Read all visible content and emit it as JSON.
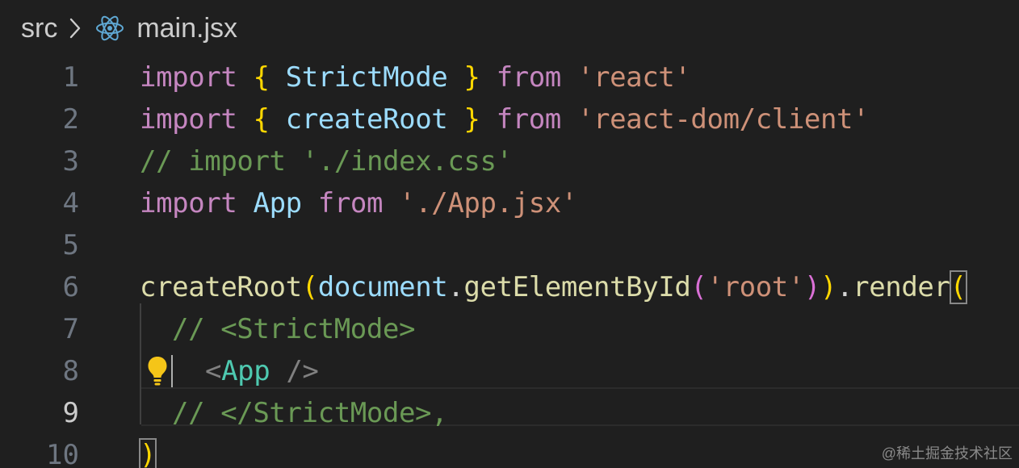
{
  "breadcrumb": {
    "folder": "src",
    "file": "main.jsx",
    "separator_icon": "chevron-right-icon",
    "file_icon": "react-icon"
  },
  "editor": {
    "active_line": "9",
    "lines": [
      {
        "num": "1",
        "tokens": [
          {
            "t": "import",
            "c": "kw"
          },
          {
            "t": " ",
            "c": "plain"
          },
          {
            "t": "{",
            "c": "br1"
          },
          {
            "t": " StrictMode ",
            "c": "ident"
          },
          {
            "t": "}",
            "c": "br1"
          },
          {
            "t": " ",
            "c": "plain"
          },
          {
            "t": "from",
            "c": "kw"
          },
          {
            "t": " ",
            "c": "plain"
          },
          {
            "t": "'react'",
            "c": "str"
          }
        ]
      },
      {
        "num": "2",
        "tokens": [
          {
            "t": "import",
            "c": "kw"
          },
          {
            "t": " ",
            "c": "plain"
          },
          {
            "t": "{",
            "c": "br1"
          },
          {
            "t": " createRoot ",
            "c": "ident"
          },
          {
            "t": "}",
            "c": "br1"
          },
          {
            "t": " ",
            "c": "plain"
          },
          {
            "t": "from",
            "c": "kw"
          },
          {
            "t": " ",
            "c": "plain"
          },
          {
            "t": "'react-dom/client'",
            "c": "str"
          }
        ]
      },
      {
        "num": "3",
        "tokens": [
          {
            "t": "// import './index.css'",
            "c": "cmt"
          }
        ]
      },
      {
        "num": "4",
        "tokens": [
          {
            "t": "import",
            "c": "kw"
          },
          {
            "t": " ",
            "c": "plain"
          },
          {
            "t": "App",
            "c": "ident"
          },
          {
            "t": " ",
            "c": "plain"
          },
          {
            "t": "from",
            "c": "kw"
          },
          {
            "t": " ",
            "c": "plain"
          },
          {
            "t": "'./App.jsx'",
            "c": "str"
          }
        ]
      },
      {
        "num": "5",
        "tokens": []
      },
      {
        "num": "6",
        "tokens": [
          {
            "t": "createRoot",
            "c": "fn"
          },
          {
            "t": "(",
            "c": "br1"
          },
          {
            "t": "document",
            "c": "ident"
          },
          {
            "t": ".",
            "c": "plain"
          },
          {
            "t": "getElementById",
            "c": "fn"
          },
          {
            "t": "(",
            "c": "br2"
          },
          {
            "t": "'root'",
            "c": "str"
          },
          {
            "t": ")",
            "c": "br2"
          },
          {
            "t": ")",
            "c": "br1"
          },
          {
            "t": ".",
            "c": "plain"
          },
          {
            "t": "render",
            "c": "fn"
          },
          {
            "t": "(",
            "c": "br1",
            "box": true
          }
        ]
      },
      {
        "num": "7",
        "indent": 1,
        "tokens": [
          {
            "t": "// <StrictMode>",
            "c": "cmt"
          }
        ]
      },
      {
        "num": "8",
        "indent": 2,
        "bulb": true,
        "tokens": [
          {
            "t": "<",
            "c": "punc"
          },
          {
            "t": "App",
            "c": "tag"
          },
          {
            "t": " />",
            "c": "punc"
          }
        ]
      },
      {
        "num": "9",
        "indent": 1,
        "tokens": [
          {
            "t": "// </StrictMode>,",
            "c": "cmt"
          }
        ]
      },
      {
        "num": "10",
        "tokens": [
          {
            "t": ")",
            "c": "br1",
            "box": true
          }
        ]
      }
    ]
  },
  "lightbulb_icon": "lightbulb-icon",
  "watermark": "@稀土掘金技术社区"
}
